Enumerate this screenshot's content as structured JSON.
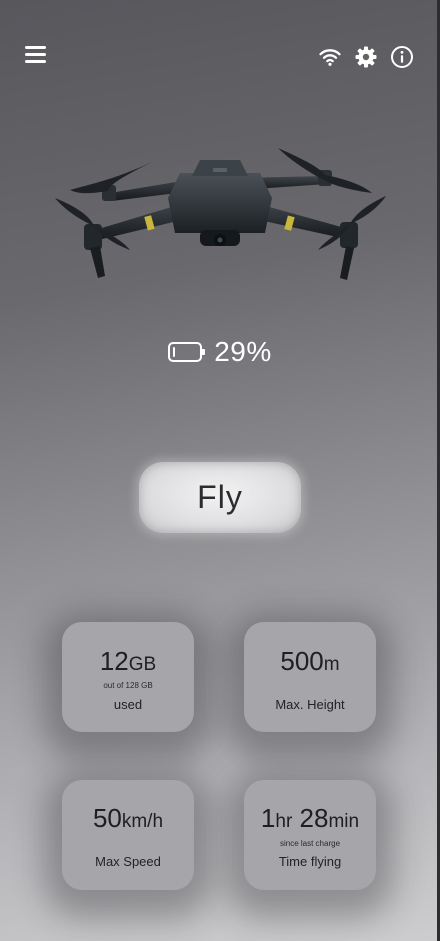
{
  "battery": {
    "text": "29%",
    "level": 0.29
  },
  "fly_button": {
    "label": "Fly"
  },
  "stats": {
    "storage": {
      "value": "12",
      "unit": "GB",
      "subtext": "out of 128 GB",
      "label": "used"
    },
    "height": {
      "value": "500",
      "unit": "m",
      "label": "Max. Height"
    },
    "speed": {
      "value": "50",
      "unit": "km/h",
      "label": "Max Speed"
    },
    "flight_time": {
      "hours": "1",
      "hours_unit": "hr",
      "minutes": "28",
      "minutes_unit": "min",
      "subtext": "since last charge",
      "label": "Time flying"
    }
  },
  "icons": {
    "menu": "menu-icon",
    "wifi": "wifi-icon",
    "settings": "gear-icon",
    "info": "info-icon",
    "battery": "battery-icon"
  },
  "colors": {
    "background_top": "#58575c",
    "background_bottom": "#cdcdcf",
    "card": "#a6a5aa",
    "button": "#e2e2e4",
    "accent": "#ffffff"
  }
}
